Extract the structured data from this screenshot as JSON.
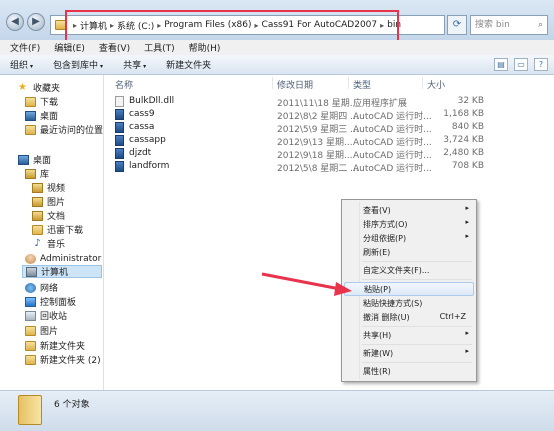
{
  "nav": {
    "back_glyph": "◀",
    "forward_glyph": "▶"
  },
  "address": {
    "crumbs": [
      "计算机",
      "系统 (C:)",
      "Program Files (x86)",
      "Cass91 For AutoCAD2007",
      "bin"
    ],
    "separator": "▸"
  },
  "search": {
    "placeholder": "搜索 bin"
  },
  "menubar": [
    "文件(F)",
    "编辑(E)",
    "查看(V)",
    "工具(T)",
    "帮助(H)"
  ],
  "toolbar": {
    "organize": "组织",
    "include": "包含到库中",
    "share": "共享",
    "new_folder": "新建文件夹",
    "dropdown_glyph": "▾"
  },
  "sidebar": {
    "favorites": "收藏夹",
    "downloads": "下载",
    "desktop": "桌面",
    "recent": "最近访问的位置",
    "desktop_root": "桌面",
    "libraries": "库",
    "videos": "视频",
    "pictures": "图片",
    "documents": "文档",
    "xunlei": "迅雷下载",
    "music": "音乐",
    "admin": "Administrator",
    "computer": "计算机",
    "network": "网络",
    "control_panel": "控制面板",
    "recycle": "回收站",
    "pictures2": "图片",
    "new_folder": "新建文件夹",
    "new_folder2": "新建文件夹 (2)"
  },
  "columns": {
    "name": "名称",
    "date": "修改日期",
    "type": "类型",
    "size": "大小"
  },
  "files": [
    {
      "name": "BulkDll.dll",
      "date": "2011\\11\\18 星期...",
      "type": "应用程序扩展",
      "size": "32 KB",
      "icon": "dll"
    },
    {
      "name": "cass9",
      "date": "2012\\8\\2 星期四 ...",
      "type": "AutoCAD 运行时...",
      "size": "1,168 KB",
      "icon": "cad"
    },
    {
      "name": "cassa",
      "date": "2012\\5\\9 星期三 ...",
      "type": "AutoCAD 运行时...",
      "size": "840 KB",
      "icon": "cad"
    },
    {
      "name": "cassapp",
      "date": "2012\\9\\13 星期...",
      "type": "AutoCAD 运行时...",
      "size": "3,724 KB",
      "icon": "cad"
    },
    {
      "name": "djzdt",
      "date": "2012\\9\\18 星期...",
      "type": "AutoCAD 运行时...",
      "size": "2,480 KB",
      "icon": "cad"
    },
    {
      "name": "landform",
      "date": "2012\\5\\8 星期二 ...",
      "type": "AutoCAD 运行时...",
      "size": "708 KB",
      "icon": "cad"
    }
  ],
  "context_menu": {
    "view": "查看(V)",
    "sort": "排序方式(O)",
    "group": "分组依据(P)",
    "refresh": "刷新(E)",
    "customize": "自定义文件夹(F)...",
    "paste": "粘贴(P)",
    "paste_shortcut": "粘贴快捷方式(S)",
    "undo": "撤消 删除(U)",
    "undo_shortcut": "Ctrl+Z",
    "share": "共享(H)",
    "new": "新建(W)",
    "properties": "属性(R)",
    "submenu_glyph": "▸"
  },
  "status": {
    "count": "6 个对象"
  },
  "colors": {
    "highlight_box": "#e8334a",
    "arrow": "#e8334a"
  }
}
